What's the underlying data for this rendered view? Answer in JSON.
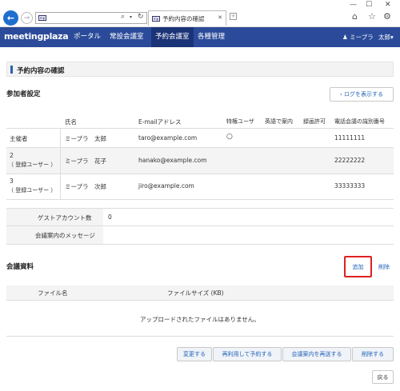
{
  "browser": {
    "tab_title": "予約内容の確認",
    "win_min": "—",
    "win_max": "☐",
    "win_close": "✕",
    "search_symbol": "⌕",
    "refresh_symbol": "↻"
  },
  "nav": {
    "logo": "meetingplaza",
    "items": [
      "ポータル",
      "常設会議室",
      "予約会議室",
      "各種管理"
    ],
    "active_index": 2,
    "user": "ミープラ",
    "user_menu": "太郎"
  },
  "page": {
    "title": "予約内容の確認",
    "participants_heading": "参加者設定",
    "log_button": "ログを表示する",
    "columns": [
      "氏名",
      "E-mailアドレス",
      "特権ユーザ",
      "英語で案内",
      "録画許可",
      "電話会議の識別番号"
    ],
    "rows": [
      {
        "role_line1": "主催者",
        "role_line2": "",
        "name": "ミープラ　太郎",
        "email": "taro@example.com",
        "privileged": "○",
        "phone": "11111111"
      },
      {
        "role_line1": "2",
        "role_line2": "（ 登録ユーザー ）",
        "name": "ミープラ　花子",
        "email": "hanako@example.com",
        "privileged": "",
        "phone": "22222222"
      },
      {
        "role_line1": "3",
        "role_line2": "（ 登録ユーザー ）",
        "name": "ミープラ　次郎",
        "email": "jiro@example.com",
        "privileged": "",
        "phone": "33333333"
      }
    ],
    "guest_label": "ゲストアカウント数",
    "guest_value": "0",
    "message_label": "会議案内のメッセージ",
    "message_value": "",
    "materials_heading": "会議資料",
    "add_button": "追加",
    "delete_button": "削除",
    "file_columns": [
      "ファイル名",
      "ファイルサイズ (KB)"
    ],
    "no_files": "アップロードされたファイルはありません。",
    "actions": [
      "変更する",
      "再利用して予約する",
      "会議案内を再送する",
      "削除する"
    ],
    "back_button": "戻る"
  },
  "colors": {
    "navbar": "#2b4b9a",
    "accent": "#2262b8",
    "highlight": "#e02020"
  }
}
